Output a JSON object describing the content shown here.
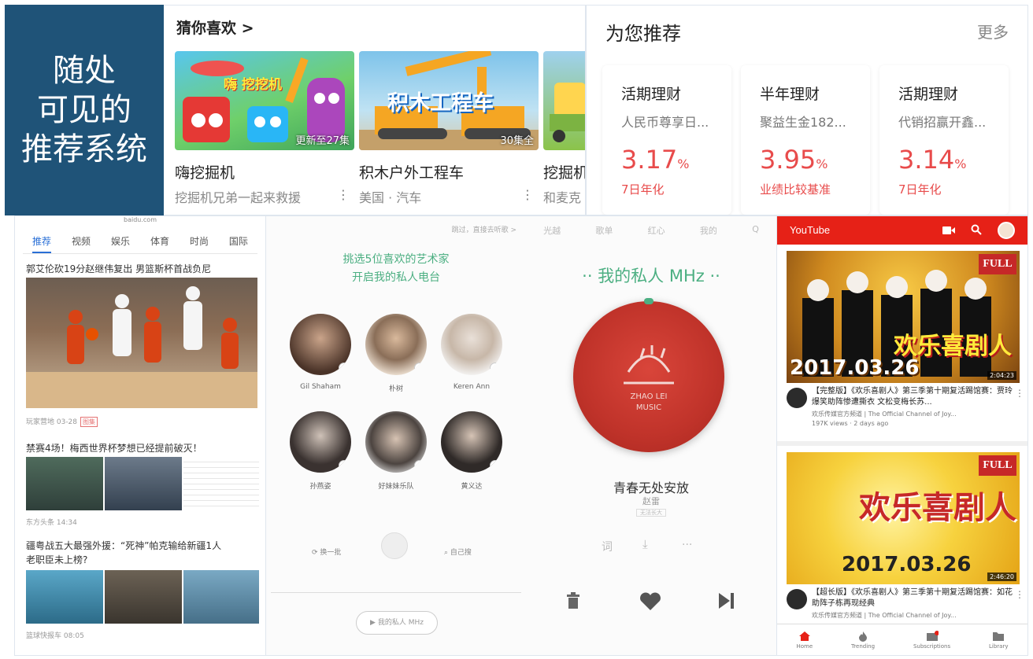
{
  "title_box": {
    "line1": "随处",
    "line2": "可见的",
    "line3": "推荐系统"
  },
  "video": {
    "header": "猜你喜欢 >",
    "cards": [
      {
        "thumb_text": "嗨 挖挖机",
        "badge": "更新至27集",
        "title": "嗨挖掘机",
        "subtitle": "挖掘机兄弟一起来救援"
      },
      {
        "thumb_text": "积木工程车",
        "badge": "30集全",
        "title": "积木户外工程车",
        "subtitle": "美国 · 汽车"
      },
      {
        "thumb_text": "",
        "badge": "",
        "title": "挖掘机",
        "subtitle": "和麦克"
      }
    ]
  },
  "finance": {
    "header": "为您推荐",
    "more": "更多",
    "cards": [
      {
        "title": "活期理财",
        "sub": "人民币尊享日...",
        "rate": "3.17",
        "unit": "%",
        "desc": "7日年化"
      },
      {
        "title": "半年理财",
        "sub": "聚益生金182...",
        "rate": "3.95",
        "unit": "%",
        "desc": "业绩比较基准"
      },
      {
        "title": "活期理财",
        "sub": "代销招赢开鑫...",
        "rate": "3.14",
        "unit": "%",
        "desc": "7日年化"
      }
    ]
  },
  "news": {
    "url": "baidu.com",
    "tabs": [
      "推荐",
      "视频",
      "娱乐",
      "体育",
      "时尚",
      "国际"
    ],
    "items": [
      {
        "headline": "郭艾伦砍19分赵继伟复出 男篮斯杯首战负尼",
        "meta": "玩家营地 03-28",
        "tag": "图集"
      },
      {
        "headline": "禁赛4场！梅西世界杯梦想已经提前破灭！",
        "meta": "东方头条 14:34",
        "tag": ""
      },
      {
        "headline": "疆粤战五大最强外援：“死神”帕克输给新疆1人",
        "headline2": "老职臣未上榜?",
        "meta": "篮球快报车 08:05",
        "tag": ""
      }
    ]
  },
  "music": {
    "skip": "跳过，直接去听歌 >",
    "pick_line1": "挑选5位喜欢的艺术家",
    "pick_line2": "开启我的私人电台",
    "artists": [
      "Gil Shaham",
      "朴树",
      "Keren Ann",
      "孙燕姿",
      "好妹妹乐队",
      "黄义达"
    ],
    "refresh": "换一批",
    "search": "自己搜",
    "bottom_btn": "▶ 我的私人 MHz",
    "tabs": [
      "光越",
      "歌单",
      "红心",
      "我的",
      "Q"
    ],
    "mhz_title": "·· 我的私人 MHz ··",
    "disc_text1": "ZHAO LEI",
    "disc_text2": "MUSIC",
    "song": "青春无处安放",
    "artist": "赵雷",
    "album_tag": "无法长大",
    "ctrl_lyrics": "词",
    "ctrl_more": "···"
  },
  "youtube": {
    "brand": "YouTube",
    "cards": [
      {
        "full": "FULL",
        "date": "2017.03.26",
        "show": "欢乐喜剧人",
        "duration": "2:04:23",
        "title": "【完整版】《欢乐喜剧人》第三季第十期复活踢馆赛：贾玲爆笑助阵惨遭撕衣 文松变梅长苏...",
        "channel": "欢乐传媒官方频道 | The Official Channel of Joy...",
        "views": "197K views · 2 days ago"
      },
      {
        "full": "FULL",
        "date": "2017.03.26",
        "show": "欢乐喜剧人",
        "duration": "2:46:20",
        "title": "【超长版】《欢乐喜剧人》第三季第十期复活踢馆赛：如花助阵子栋再现经典",
        "channel": "欢乐传媒官方频道 | The Official Channel of Joy...",
        "views": ""
      }
    ],
    "nav": [
      "Home",
      "Trending",
      "Subscriptions",
      "Library"
    ]
  },
  "colors": {
    "title_bg": "#1f5378",
    "rate_red": "#e84b4b",
    "music_green": "#4caf82",
    "yt_red": "#e62117"
  }
}
